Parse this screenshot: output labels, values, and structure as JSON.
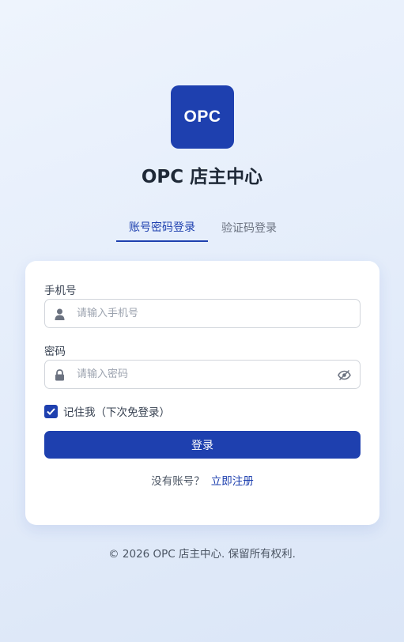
{
  "brand": {
    "logo_text": "OPC",
    "title": "OPC 店主中心"
  },
  "tabs": [
    {
      "label": "账号密码登录",
      "active": true
    },
    {
      "label": "验证码登录",
      "active": false
    }
  ],
  "form": {
    "phone": {
      "label": "手机号",
      "placeholder": "请输入手机号",
      "icon": "user-icon"
    },
    "password": {
      "label": "密码",
      "placeholder": "请输入密码",
      "icon": "lock-icon",
      "toggle_icon": "eye-off-icon"
    },
    "remember": {
      "label": "记住我（下次免登录）",
      "checked": true
    },
    "submit_label": "登录",
    "signup_prompt": "没有账号？",
    "signup_link": "立即注册"
  },
  "footer": {
    "copyright": "© 2026 OPC 店主中心. 保留所有权利."
  },
  "colors": {
    "primary": "#1e40af",
    "background": "#e6eefb",
    "card": "#ffffff"
  }
}
